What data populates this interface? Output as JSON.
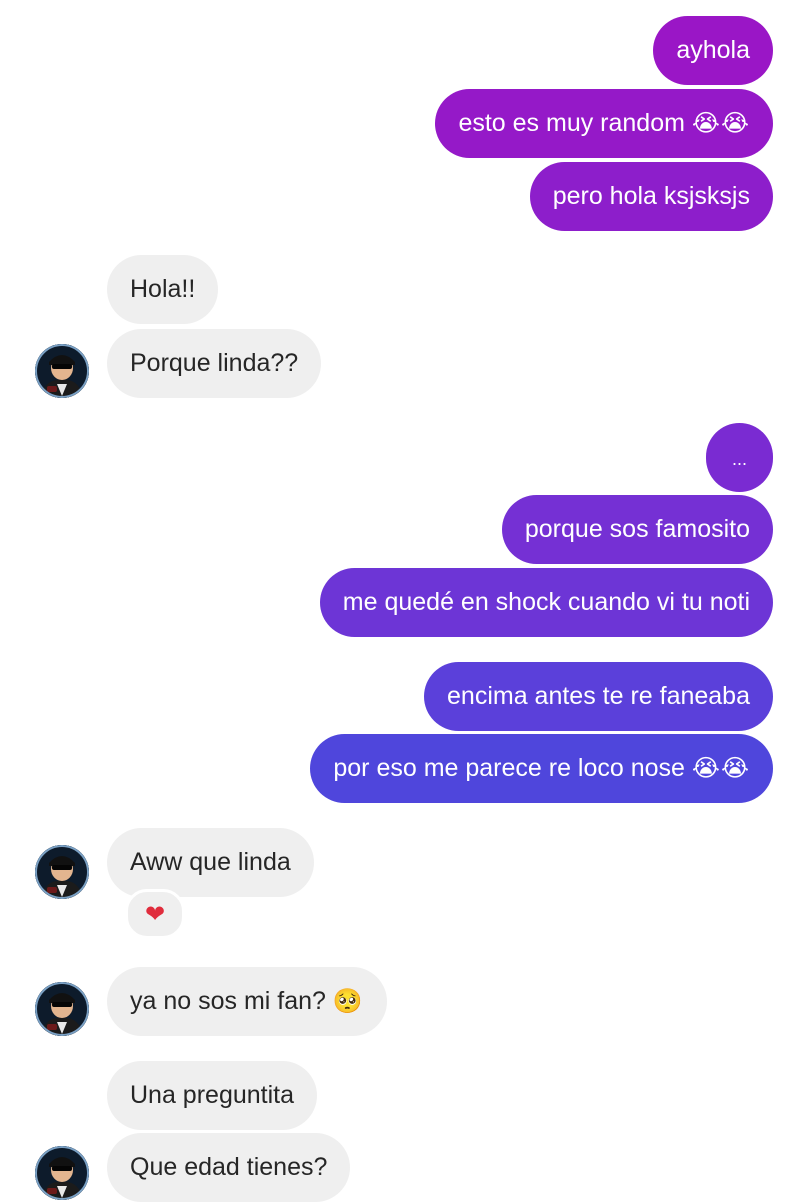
{
  "colors": {
    "sent_top": "#9a16c6",
    "sent_mid": "#6a34d6",
    "sent_bottom": "#4f46dc",
    "received_bg": "#efefef",
    "received_text": "#262626"
  },
  "messages": [
    {
      "id": "m1",
      "direction": "sent",
      "text": "ayhola"
    },
    {
      "id": "m2",
      "direction": "sent",
      "text": "esto es muy random",
      "emoji": "😭😭"
    },
    {
      "id": "m3",
      "direction": "sent",
      "text": "pero hola ksjsksjs"
    },
    {
      "id": "m4",
      "direction": "received",
      "text": "Hola!!"
    },
    {
      "id": "m5",
      "direction": "received",
      "text": "Porque linda??"
    },
    {
      "id": "m6",
      "direction": "sent",
      "text": "..."
    },
    {
      "id": "m7",
      "direction": "sent",
      "text": "porque sos famosito"
    },
    {
      "id": "m8",
      "direction": "sent",
      "text": "me quedé en shock cuando vi tu noti"
    },
    {
      "id": "m9",
      "direction": "sent",
      "text": "encima antes te re faneaba"
    },
    {
      "id": "m10",
      "direction": "sent",
      "text": "por eso me parece re loco nose",
      "emoji": "😭😭"
    },
    {
      "id": "m11",
      "direction": "received",
      "text": "Aww que linda",
      "reaction": "❤"
    },
    {
      "id": "m12",
      "direction": "received",
      "text": "ya no sos mi fan?",
      "emoji": "🥺"
    },
    {
      "id": "m13",
      "direction": "received",
      "text": "Una preguntita"
    },
    {
      "id": "m14",
      "direction": "received",
      "text": "Que edad tienes?"
    }
  ],
  "icons": {
    "avatar": "contact-avatar",
    "reaction": "heart-icon",
    "crying": "loudly-crying-face-icon",
    "pleading": "pleading-face-icon"
  }
}
